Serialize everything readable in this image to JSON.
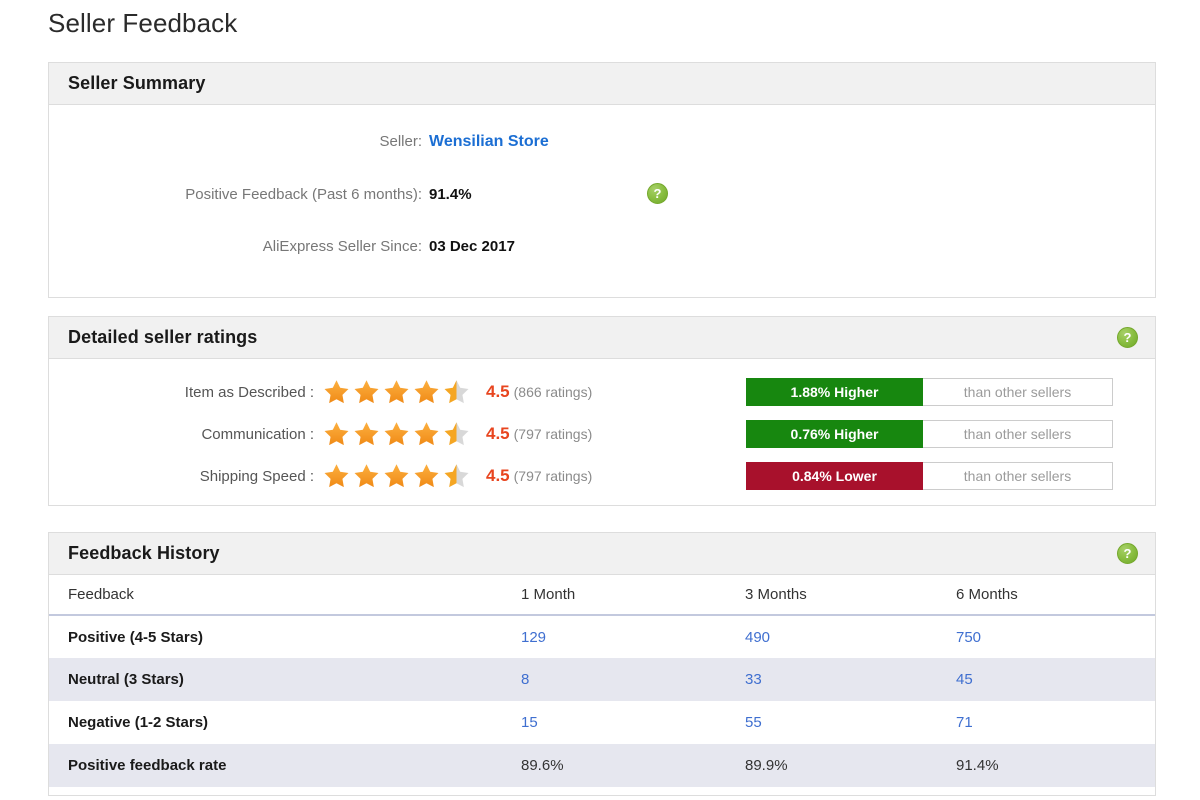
{
  "page": {
    "title": "Seller Feedback"
  },
  "summary": {
    "header": "Seller Summary",
    "rows": [
      {
        "label": "Seller:",
        "value": "Wensilian Store",
        "is_link": true
      },
      {
        "label": "Positive Feedback (Past 6 months):",
        "value": "91.4%",
        "is_link": false
      },
      {
        "label": "AliExpress Seller Since:",
        "value": "03 Dec 2017",
        "is_link": false
      }
    ],
    "help_icon": "help-question-icon"
  },
  "ratings": {
    "header": "Detailed seller ratings",
    "help_icon": "help-question-icon",
    "rows": [
      {
        "label": "Item as Described :",
        "score": "4.5",
        "stars": 4.5,
        "count": "(866 ratings)",
        "compare_value": "1.88% Higher",
        "compare_direction": "higher",
        "compare_note": "than other sellers"
      },
      {
        "label": "Communication :",
        "score": "4.5",
        "stars": 4.5,
        "count": "(797 ratings)",
        "compare_value": "0.76% Higher",
        "compare_direction": "higher",
        "compare_note": "than other sellers"
      },
      {
        "label": "Shipping Speed :",
        "score": "4.5",
        "stars": 4.5,
        "count": "(797 ratings)",
        "compare_value": "0.84% Lower",
        "compare_direction": "lower",
        "compare_note": "than other sellers"
      }
    ]
  },
  "history": {
    "header": "Feedback History",
    "help_icon": "help-question-icon",
    "columns": [
      "Feedback",
      "1 Month",
      "3 Months",
      "6 Months"
    ],
    "rows": [
      {
        "label": "Positive (4-5 Stars)",
        "values": [
          "129",
          "490",
          "750"
        ],
        "style": "link"
      },
      {
        "label": "Neutral (3 Stars)",
        "values": [
          "8",
          "33",
          "45"
        ],
        "style": "link"
      },
      {
        "label": "Negative (1-2 Stars)",
        "values": [
          "15",
          "55",
          "71"
        ],
        "style": "link"
      },
      {
        "label": "Positive feedback rate",
        "values": [
          "89.6%",
          "89.9%",
          "91.4%"
        ],
        "style": "plain"
      }
    ]
  },
  "colors": {
    "accent_link": "#3f6fd0",
    "seller_link": "#1b6ed3",
    "score_orange": "#e8451f",
    "star_gold": "#f5a623",
    "badge_green": "#17870f",
    "badge_red": "#a8112c",
    "panel_header_bg": "#f1f1f1",
    "row_alt_bg": "#e6e7ef"
  }
}
